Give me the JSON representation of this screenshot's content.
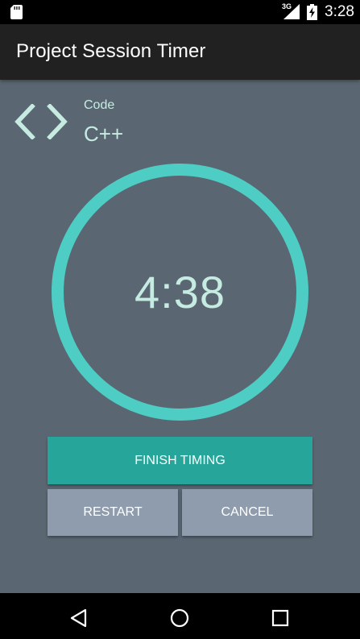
{
  "status_bar": {
    "network": "3G",
    "time": "3:28",
    "icons": [
      "sd-card-icon",
      "signal-icon",
      "battery-charging-icon"
    ]
  },
  "app_bar": {
    "title": "Project Session Timer"
  },
  "session": {
    "category_label": "Code",
    "category_value": "C++",
    "category_icon": "code-brackets-icon",
    "timer": "4:38"
  },
  "actions": {
    "finish_label": "FINISH TIMING",
    "restart_label": "RESTART",
    "cancel_label": "CANCEL"
  },
  "nav_bar": {
    "icons": [
      "back-icon",
      "home-icon",
      "recents-icon"
    ]
  },
  "colors": {
    "accent": "#4ecdc4",
    "background": "#5a6772",
    "primary_button": "#26a69a",
    "secondary_button": "#8e9cae",
    "app_bar": "#212121",
    "text_light": "#c6ece2"
  }
}
